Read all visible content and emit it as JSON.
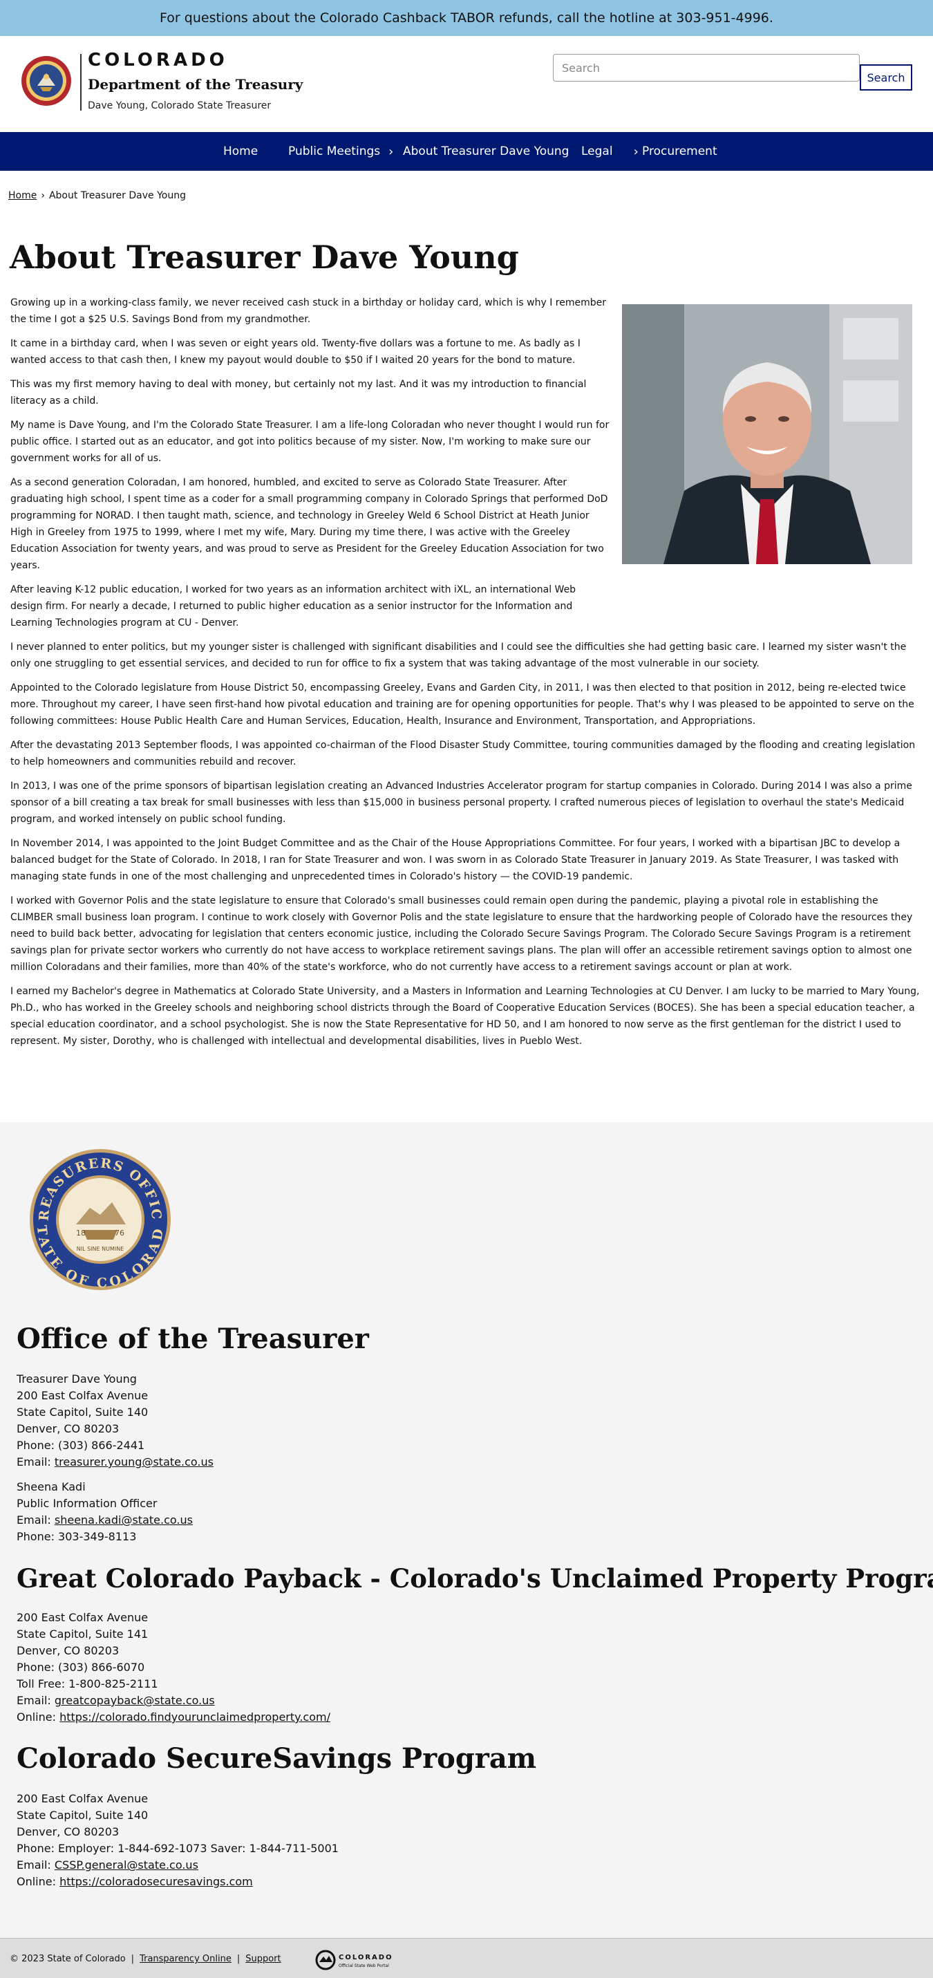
{
  "alert": {
    "text": "For questions about the Colorado Cashback TABOR refunds, call the hotline at 303-951-4996."
  },
  "header": {
    "brand": "COLORADO",
    "department": "Department of the Treasury",
    "subtitle": "Dave Young, Colorado State Treasurer",
    "search_placeholder": "Search",
    "search_button": "Search"
  },
  "nav": {
    "items": [
      {
        "label": "Home"
      },
      {
        "label": "Public Meetings",
        "arrow": "›"
      },
      {
        "label": "About Treasurer Dave Young"
      },
      {
        "label": "Legal",
        "arrow": "›"
      },
      {
        "label": "Procurement"
      }
    ]
  },
  "breadcrumb": {
    "home": "Home",
    "separator": "›",
    "current": "About Treasurer Dave Young"
  },
  "page": {
    "title": "About Treasurer Dave Young",
    "paragraphs": [
      "Growing up in a working-class family, we never received cash stuck in a birthday or holiday card, which is why I remember the time I got a $25 U.S. Savings Bond from my grandmother.",
      "It came in a birthday card, when I was seven or eight years old. Twenty-five dollars was a fortune to me. As badly as I wanted access to that cash then, I knew my payout would double to $50 if I waited 20 years for the bond to mature.",
      "This was my first memory having to deal with money, but certainly not my last. And it was my introduction to financial literacy as a child.",
      "My name is Dave Young, and I'm the Colorado State Treasurer. I am a life-long Coloradan who never thought I would run for public office. I started out as an educator, and got into politics because of my sister. Now, I'm working to make sure our government works for all of us.",
      "As a second generation Coloradan, I am honored, humbled, and excited to serve as Colorado State Treasurer. After graduating high school, I spent time as a coder for a small programming company in Colorado Springs that performed DoD programming for NORAD. I then taught math, science, and technology in Greeley Weld 6 School District at Heath Junior High in Greeley from 1975 to 1999, where I met my wife, Mary. During my time there, I was active with the Greeley Education Association for twenty years, and was proud to serve as President for the Greeley Education Association for two years.",
      "After leaving K-12 public education, I worked for two years as an information architect with iXL, an international Web design firm. For nearly a decade, I returned to public higher education as a senior instructor for the Information and Learning Technologies program at CU - Denver.",
      "I never planned to enter politics, but my younger sister is challenged with significant disabilities and I could see the difficulties she had getting basic care. I learned my sister wasn't the only one struggling to get essential services, and decided to run for office to fix a system that was taking advantage of the most vulnerable in our society.",
      "Appointed to the Colorado legislature from House District 50, encompassing Greeley, Evans and Garden City, in 2011, I was then elected to that position in 2012, being re-elected twice more. Throughout my career, I have seen first-hand how pivotal education and training are for opening opportunities for people. That's why I was pleased to be appointed to serve on the following committees: House Public Health Care and Human Services, Education, Health, Insurance and Environment, Transportation, and Appropriations.",
      "After the devastating 2013 September floods, I was appointed co-chairman of the Flood Disaster Study Committee, touring communities damaged by the flooding and creating legislation to help homeowners and communities rebuild and recover.",
      "In 2013, I was one of the prime sponsors of bipartisan legislation creating an Advanced Industries Accelerator program for startup companies in Colorado. During 2014 I was also a prime sponsor of a bill creating a tax break for small businesses with less than $15,000 in business personal property. I crafted numerous pieces of legislation to overhaul the state's Medicaid program, and worked intensely on public school funding.",
      "In November 2014, I was appointed to the Joint Budget Committee and as the Chair of the House Appropriations Committee. For four years, I worked with a bipartisan JBC to develop a balanced budget for the State of Colorado. In 2018, I ran for State Treasurer and won. I was sworn in as Colorado State Treasurer in January 2019. As State Treasurer, I was tasked with managing state funds in one of the most challenging and unprecedented times in Colorado's history — the COVID-19 pandemic.",
      "I worked with Governor Polis and the state legislature to ensure that Colorado's small businesses could remain open during the pandemic, playing a pivotal role in establishing the CLIMBER small business loan program. I continue to work closely with Governor Polis and the state legislature to ensure that the hardworking people of Colorado have the resources they need to build back better, advocating for legislation that centers economic justice, including the Colorado Secure Savings Program. The Colorado Secure Savings Program is a retirement savings plan for private sector workers who currently do not have access to workplace retirement savings plans. The plan will offer an accessible retirement savings option to almost one million Coloradans and their families, more than 40% of the state's workforce, who do not currently have access to a retirement savings account or plan at work.",
      "I earned my Bachelor's degree in Mathematics at Colorado State University, and a Masters in Information and Learning Technologies at CU Denver. I am lucky to be married to Mary Young, Ph.D., who has worked in the Greeley schools and neighboring school districts through the Board of Cooperative Education Services (BOCES). She has been a special education teacher, a special education coordinator, and a school psychologist. She is now the State Representative for HD 50, and I am honored to now serve as the first gentleman for the district I used to represent.  My sister, Dorothy, who is challenged with intellectual and developmental disabilities, lives in Pueblo West."
    ]
  },
  "footer": {
    "seal": {
      "top_text": "TREASURERS OFFICE",
      "bottom_text": "STATE OF COLORADO",
      "motto": "NIL SINE NUMINE",
      "year_left": "18",
      "year_right": "76"
    },
    "office": {
      "heading": "Office of the Treasurer",
      "lines": [
        "Treasurer Dave Young",
        "200 East Colfax Avenue",
        "State Capitol, Suite 140",
        "Denver, CO 80203",
        "Phone: (303) 866-2441"
      ],
      "email_label": "Email: ",
      "email": "treasurer.young@state.co.us",
      "contact_lines": [
        "Sheena Kadi",
        "Public Information Officer"
      ],
      "contact_email_label": "Email: ",
      "contact_email": "sheena.kadi@state.co.us",
      "contact_phone": "Phone: 303-349-8113"
    },
    "payback": {
      "heading": "Great Colorado Payback - Colorado's Unclaimed Property Program",
      "lines": [
        "200 East Colfax Avenue",
        "State Capitol, Suite 141",
        "Denver, CO 80203",
        "Phone: (303) 866-6070",
        "Toll Free:  1-800-825-2111"
      ],
      "email_label": "Email: ",
      "email": "greatcopayback@state.co.us",
      "online_label": "Online: ",
      "online": "https://colorado.findyourunclaimedproperty.com/"
    },
    "secure": {
      "heading": "Colorado SecureSavings Program",
      "lines": [
        "200 East Colfax Avenue",
        "State Capitol, Suite 140",
        "Denver, CO 80203",
        "Phone: Employer: 1-844-692-1073  Saver: 1-844-711-5001"
      ],
      "email_label": "Email: ",
      "email": "CSSP.general@state.co.us",
      "online_label": "Online: ",
      "online": "https://coloradosecuresavings.com"
    }
  },
  "bottom": {
    "copyright": "© 2023 State of Colorado",
    "separator": "|",
    "links": [
      "Transparency Online",
      "Support"
    ],
    "portal_brand": "COLORADO",
    "portal_sub": "Official State Web Portal"
  },
  "colors": {
    "nav": "#001970",
    "alert": "#8fc4e3",
    "footer": "#f4f4f4",
    "bottom_bar": "#dddddd"
  }
}
